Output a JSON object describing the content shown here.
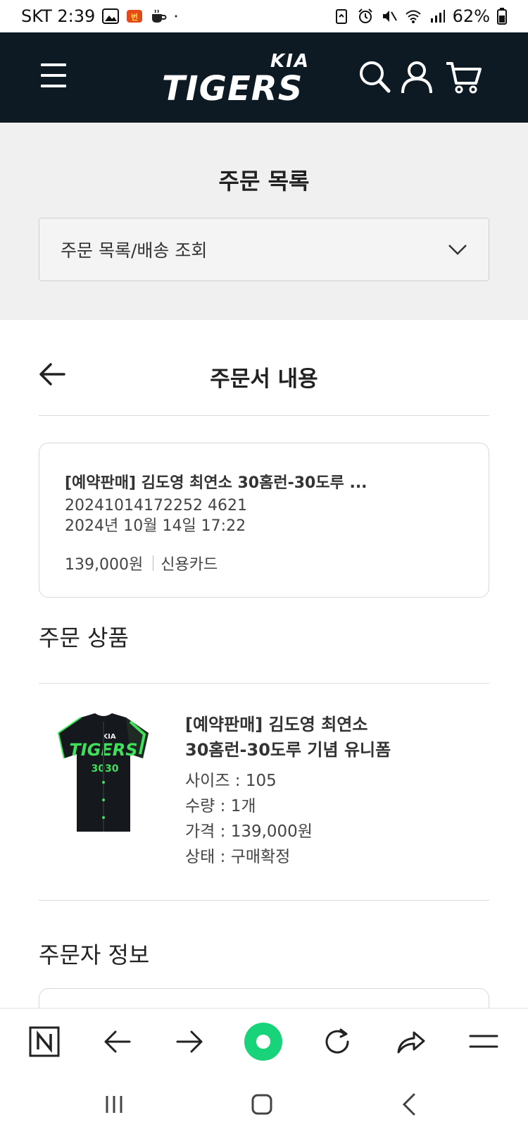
{
  "status_bar": {
    "carrier_time": "SKT 2:39",
    "battery": "62%"
  },
  "top_nav": {
    "logo_top": "KIA",
    "logo_main": "TIGERS",
    "icons": [
      "menu-icon",
      "search-icon",
      "user-icon",
      "cart-icon"
    ]
  },
  "page": {
    "title": "주문 목록",
    "dropdown_value": "주문 목록/배송 조회"
  },
  "order_detail": {
    "title": "주문서 내용",
    "product_name": "[예약판매] 김도영 최연소 30홈런-30도루 ...",
    "order_number": "20241014172252 4621",
    "order_date": "2024년 10월 14일 17:22",
    "amount": "139,000원",
    "payment_method": "신용카드"
  },
  "ordered_items": {
    "section_title": "주문 상품",
    "items": [
      {
        "name_line1": "[예약판매] 김도영 최연소",
        "name_line2": "30홈런-30도루 기념 유니폼",
        "size": "사이즈 : 105",
        "quantity": "수량 : 1개",
        "price": "가격 : 139,000원",
        "status": "상태 : 구매확정"
      }
    ]
  },
  "orderer_info": {
    "section_title": "주문자 정보"
  },
  "colors": {
    "nav_bg": "#0d1a24",
    "band_bg": "#f0f0f0",
    "accent_green": "#19d37a"
  }
}
